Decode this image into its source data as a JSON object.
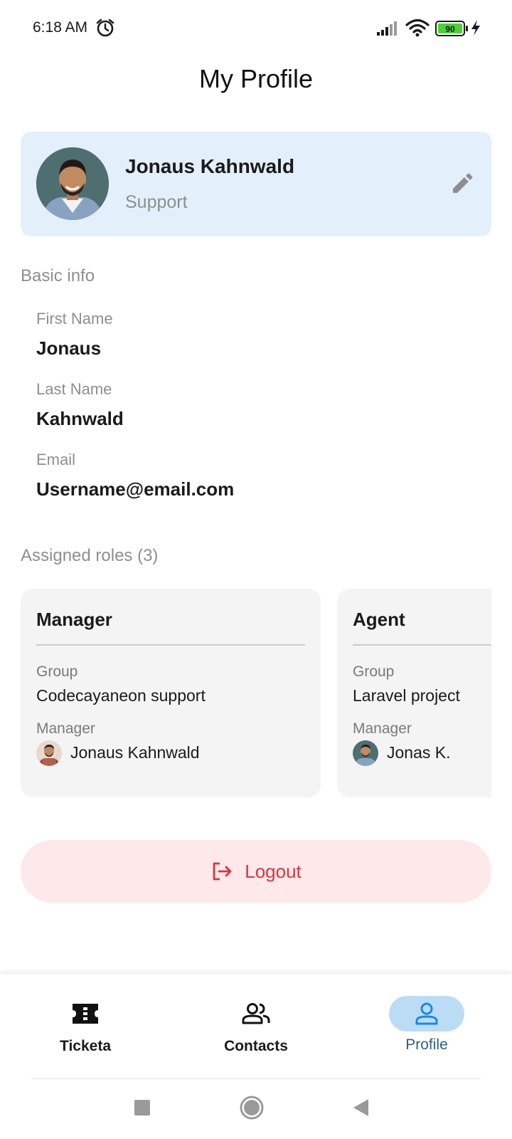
{
  "status_bar": {
    "time": "6:18 AM",
    "battery_level": "90",
    "icons": [
      "alarm-icon",
      "signal-icon",
      "wifi-icon",
      "battery-icon",
      "charging-bolt-icon"
    ]
  },
  "header": {
    "title": "My Profile"
  },
  "profile": {
    "name": "Jonaus Kahnwald",
    "role": "Support",
    "edit_icon": "pencil-icon"
  },
  "basic_info": {
    "title": "Basic info",
    "fields": [
      {
        "label": "First Name",
        "value": "Jonaus"
      },
      {
        "label": "Last Name",
        "value": "Kahnwald"
      },
      {
        "label": "Email",
        "value": "Username@email.com"
      }
    ]
  },
  "roles": {
    "title": "Assigned roles (3)",
    "items": [
      {
        "title": "Manager",
        "group_label": "Group",
        "group": "Codecayaneon support",
        "manager_label": "Manager",
        "manager": "Jonaus Kahnwald"
      },
      {
        "title": "Agent",
        "group_label": "Group",
        "group": "Laravel project",
        "manager_label": "Manager",
        "manager": "Jonas K."
      }
    ]
  },
  "logout": {
    "label": "Logout",
    "icon": "logout-icon"
  },
  "bottom_nav": {
    "items": [
      {
        "label": "Ticketa",
        "icon": "ticket-icon",
        "active": false
      },
      {
        "label": "Contacts",
        "icon": "contacts-icon",
        "active": false
      },
      {
        "label": "Profile",
        "icon": "person-icon",
        "active": true
      }
    ]
  },
  "colors": {
    "profile_card_bg": "#e3f0fb",
    "logout_bg": "#fde8ea",
    "logout_text": "#d9363e",
    "nav_active_bg": "#bcdcf5",
    "nav_active_icon": "#1e88e5",
    "battery_green": "#4cd137"
  }
}
